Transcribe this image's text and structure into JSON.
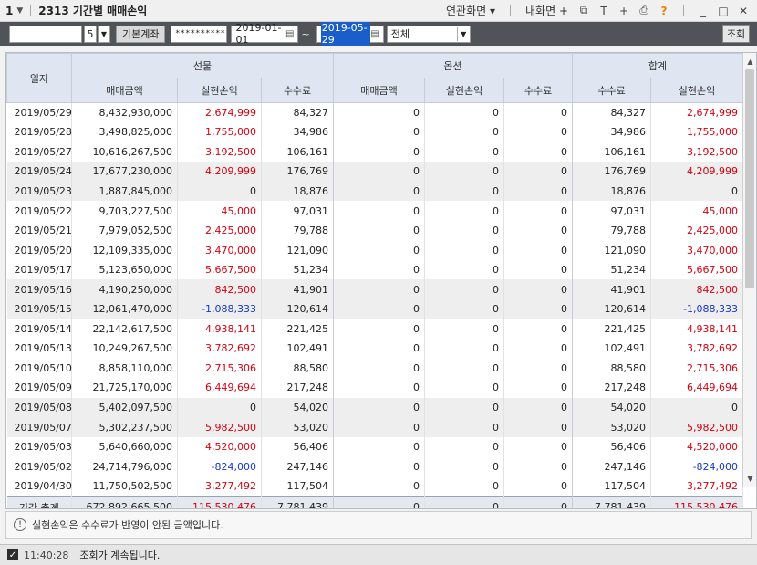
{
  "window": {
    "index": "1",
    "title": "2313 기간별 매매손익",
    "links": [
      "연관화면",
      "내화면"
    ],
    "help": "?"
  },
  "toolbar": {
    "account_number": "",
    "account_suffix": "5",
    "account_type": "기본계좌",
    "password_mask": "**********",
    "date_from": "2019-01-01",
    "date_to": "2019-05-29",
    "filter": "전체",
    "query_button": "조회"
  },
  "table": {
    "headers": {
      "date": "일자",
      "futures": "선물",
      "options": "옵션",
      "total": "합계",
      "trade_amount": "매매금액",
      "realized_pl": "실현손익",
      "fee": "수수료"
    },
    "rows": [
      {
        "date": "2019/05/29",
        "f_amt": "8,432,930,000",
        "f_pl": "2,674,999",
        "f_fee": "84,327",
        "o_amt": "0",
        "o_pl": "0",
        "o_fee": "0",
        "t_fee": "84,327",
        "t_pl": "2,674,999"
      },
      {
        "date": "2019/05/28",
        "f_amt": "3,498,825,000",
        "f_pl": "1,755,000",
        "f_fee": "34,986",
        "o_amt": "0",
        "o_pl": "0",
        "o_fee": "0",
        "t_fee": "34,986",
        "t_pl": "1,755,000"
      },
      {
        "date": "2019/05/27",
        "f_amt": "10,616,267,500",
        "f_pl": "3,192,500",
        "f_fee": "106,161",
        "o_amt": "0",
        "o_pl": "0",
        "o_fee": "0",
        "t_fee": "106,161",
        "t_pl": "3,192,500"
      },
      {
        "date": "2019/05/24",
        "f_amt": "17,677,230,000",
        "f_pl": "4,209,999",
        "f_fee": "176,769",
        "o_amt": "0",
        "o_pl": "0",
        "o_fee": "0",
        "t_fee": "176,769",
        "t_pl": "4,209,999"
      },
      {
        "date": "2019/05/23",
        "f_amt": "1,887,845,000",
        "f_pl": "0",
        "f_fee": "18,876",
        "o_amt": "0",
        "o_pl": "0",
        "o_fee": "0",
        "t_fee": "18,876",
        "t_pl": "0"
      },
      {
        "date": "2019/05/22",
        "f_amt": "9,703,227,500",
        "f_pl": "45,000",
        "f_fee": "97,031",
        "o_amt": "0",
        "o_pl": "0",
        "o_fee": "0",
        "t_fee": "97,031",
        "t_pl": "45,000"
      },
      {
        "date": "2019/05/21",
        "f_amt": "7,979,052,500",
        "f_pl": "2,425,000",
        "f_fee": "79,788",
        "o_amt": "0",
        "o_pl": "0",
        "o_fee": "0",
        "t_fee": "79,788",
        "t_pl": "2,425,000"
      },
      {
        "date": "2019/05/20",
        "f_amt": "12,109,335,000",
        "f_pl": "3,470,000",
        "f_fee": "121,090",
        "o_amt": "0",
        "o_pl": "0",
        "o_fee": "0",
        "t_fee": "121,090",
        "t_pl": "3,470,000"
      },
      {
        "date": "2019/05/17",
        "f_amt": "5,123,650,000",
        "f_pl": "5,667,500",
        "f_fee": "51,234",
        "o_amt": "0",
        "o_pl": "0",
        "o_fee": "0",
        "t_fee": "51,234",
        "t_pl": "5,667,500"
      },
      {
        "date": "2019/05/16",
        "f_amt": "4,190,250,000",
        "f_pl": "842,500",
        "f_fee": "41,901",
        "o_amt": "0",
        "o_pl": "0",
        "o_fee": "0",
        "t_fee": "41,901",
        "t_pl": "842,500"
      },
      {
        "date": "2019/05/15",
        "f_amt": "12,061,470,000",
        "f_pl": "-1,088,333",
        "f_fee": "120,614",
        "o_amt": "0",
        "o_pl": "0",
        "o_fee": "0",
        "t_fee": "120,614",
        "t_pl": "-1,088,333"
      },
      {
        "date": "2019/05/14",
        "f_amt": "22,142,617,500",
        "f_pl": "4,938,141",
        "f_fee": "221,425",
        "o_amt": "0",
        "o_pl": "0",
        "o_fee": "0",
        "t_fee": "221,425",
        "t_pl": "4,938,141"
      },
      {
        "date": "2019/05/13",
        "f_amt": "10,249,267,500",
        "f_pl": "3,782,692",
        "f_fee": "102,491",
        "o_amt": "0",
        "o_pl": "0",
        "o_fee": "0",
        "t_fee": "102,491",
        "t_pl": "3,782,692"
      },
      {
        "date": "2019/05/10",
        "f_amt": "8,858,110,000",
        "f_pl": "2,715,306",
        "f_fee": "88,580",
        "o_amt": "0",
        "o_pl": "0",
        "o_fee": "0",
        "t_fee": "88,580",
        "t_pl": "2,715,306"
      },
      {
        "date": "2019/05/09",
        "f_amt": "21,725,170,000",
        "f_pl": "6,449,694",
        "f_fee": "217,248",
        "o_amt": "0",
        "o_pl": "0",
        "o_fee": "0",
        "t_fee": "217,248",
        "t_pl": "6,449,694"
      },
      {
        "date": "2019/05/08",
        "f_amt": "5,402,097,500",
        "f_pl": "0",
        "f_fee": "54,020",
        "o_amt": "0",
        "o_pl": "0",
        "o_fee": "0",
        "t_fee": "54,020",
        "t_pl": "0"
      },
      {
        "date": "2019/05/07",
        "f_amt": "5,302,237,500",
        "f_pl": "5,982,500",
        "f_fee": "53,020",
        "o_amt": "0",
        "o_pl": "0",
        "o_fee": "0",
        "t_fee": "53,020",
        "t_pl": "5,982,500"
      },
      {
        "date": "2019/05/03",
        "f_amt": "5,640,660,000",
        "f_pl": "4,520,000",
        "f_fee": "56,406",
        "o_amt": "0",
        "o_pl": "0",
        "o_fee": "0",
        "t_fee": "56,406",
        "t_pl": "4,520,000"
      },
      {
        "date": "2019/05/02",
        "f_amt": "24,714,796,000",
        "f_pl": "-824,000",
        "f_fee": "247,146",
        "o_amt": "0",
        "o_pl": "0",
        "o_fee": "0",
        "t_fee": "247,146",
        "t_pl": "-824,000"
      },
      {
        "date": "2019/04/30",
        "f_amt": "11,750,502,500",
        "f_pl": "3,277,492",
        "f_fee": "117,504",
        "o_amt": "0",
        "o_pl": "0",
        "o_fee": "0",
        "t_fee": "117,504",
        "t_pl": "3,277,492"
      }
    ],
    "total": {
      "label": "기간 총계",
      "f_amt": "672,892,665,500",
      "f_pl": "115,530,476",
      "f_fee": "7,781,439",
      "o_amt": "0",
      "o_pl": "0",
      "o_fee": "0",
      "t_fee": "7,781,439",
      "t_pl": "115,530,476"
    }
  },
  "note": "실현손익은 수수료가 반영이 안된 금액입니다.",
  "status": {
    "time": "11:40:28",
    "message": "조회가 계속됩니다."
  },
  "colors": {
    "positive": "#d9000f",
    "negative": "#1538c9",
    "toolbar_bg": "#505358",
    "header_bg": "#dfe6f2"
  }
}
